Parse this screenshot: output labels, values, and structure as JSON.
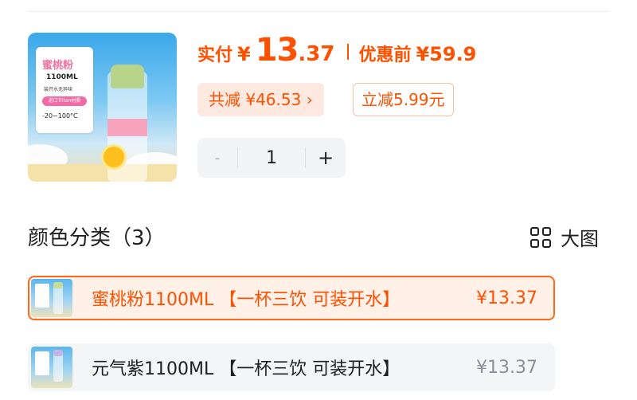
{
  "product": {
    "image_text": {
      "name": "蜜桃粉",
      "capacity": "1100ML",
      "line3": "装开水无异味",
      "line4": "进口Tritan材质",
      "temp": "-20~100°C"
    }
  },
  "price": {
    "paid_label": "实付",
    "paid_yen": "¥",
    "paid_int": "13",
    "paid_dec": ".37",
    "original_label": "优惠前",
    "original_price": "¥59.9"
  },
  "savings": {
    "total_label": "共减 ¥46.53 ›",
    "instant_label": "立减5.99元"
  },
  "stepper": {
    "minus": "-",
    "quantity": "1",
    "plus": "+"
  },
  "section": {
    "title": "颜色分类（3）",
    "bigpic_label": "大图",
    "bigpic_icon": "grid-icon"
  },
  "variants": [
    {
      "name": "蜜桃粉1100ML 【一杯三饮 可装开水】",
      "price": "¥13.37",
      "selected": true
    },
    {
      "name": "元气紫1100ML 【一杯三饮 可装开水】",
      "price": "¥13.37",
      "selected": false
    }
  ],
  "colors": {
    "accent": "#ff5000",
    "selected_bg": "#fff1e8",
    "selected_border": "#ff6a1a",
    "muted_price": "#8a8f99"
  }
}
